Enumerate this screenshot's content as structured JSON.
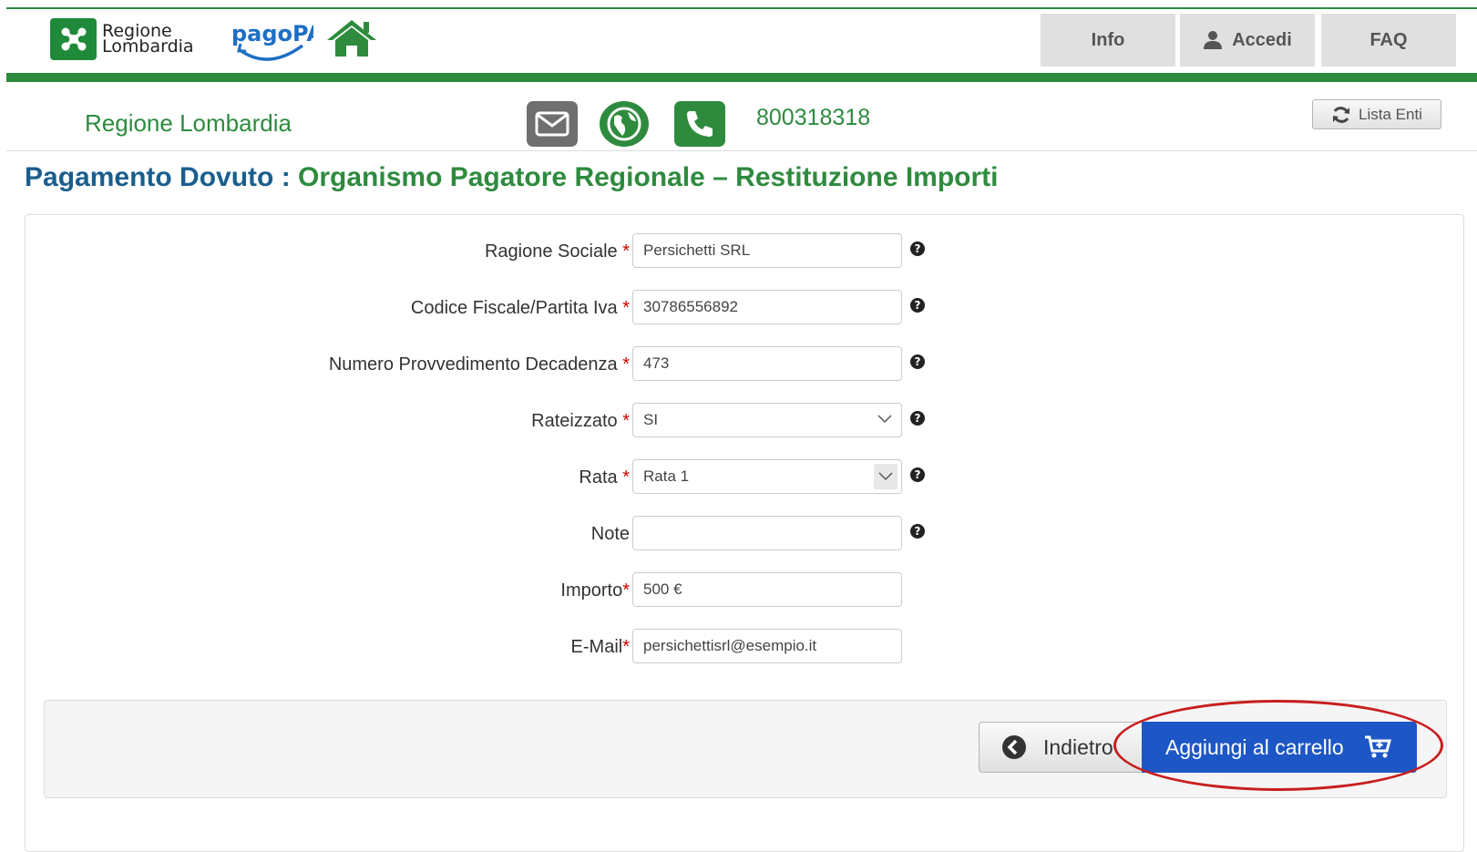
{
  "header": {
    "brand_line1": "Regione",
    "brand_line2": "Lombardia",
    "pagopa_logo": "pagoPA",
    "nav": {
      "info": "Info",
      "accedi": "Accedi",
      "faq": "FAQ"
    }
  },
  "subheader": {
    "org_name": "Regione Lombardia",
    "phone": "800318318",
    "lista_enti": "Lista Enti"
  },
  "title": {
    "prefix": "Pagamento Dovuto :",
    "main": "Organismo Pagatore Regionale – Restituzione Importi"
  },
  "form": {
    "fields": [
      {
        "label": "Ragione Sociale",
        "req": "*",
        "value": "Persichetti SRL"
      },
      {
        "label": "Codice Fiscale/Partita Iva",
        "req": "*",
        "value": "30786556892"
      },
      {
        "label": "Numero Provvedimento Decadenza",
        "req": "*",
        "value": "473"
      },
      {
        "label": "Rateizzato",
        "req": "*",
        "value": "SI"
      },
      {
        "label": "Rata",
        "req": "*",
        "value": "Rata 1"
      },
      {
        "label": "Note",
        "req": "",
        "value": ""
      },
      {
        "label": "Importo",
        "req": "*",
        "value": "500 €"
      },
      {
        "label": "E-Mail",
        "req": "*",
        "value": "persichettisrl@esempio.it"
      }
    ]
  },
  "actions": {
    "back": "Indietro",
    "add_to_cart": "Aggiungi al carrello"
  },
  "colors": {
    "brand_green": "#2e8b3e",
    "title_blue": "#1a5e8e",
    "cart_button": "#1d57c5",
    "highlight_ring": "#c81e1e"
  },
  "icons": [
    "regione-lombardia-logo",
    "pagopa-logo",
    "home-icon",
    "user-icon",
    "envelope-icon",
    "globe-icon",
    "phone-icon",
    "refresh-icon",
    "help-icon",
    "chevron-down-icon",
    "chevron-left-icon",
    "cart-icon"
  ]
}
